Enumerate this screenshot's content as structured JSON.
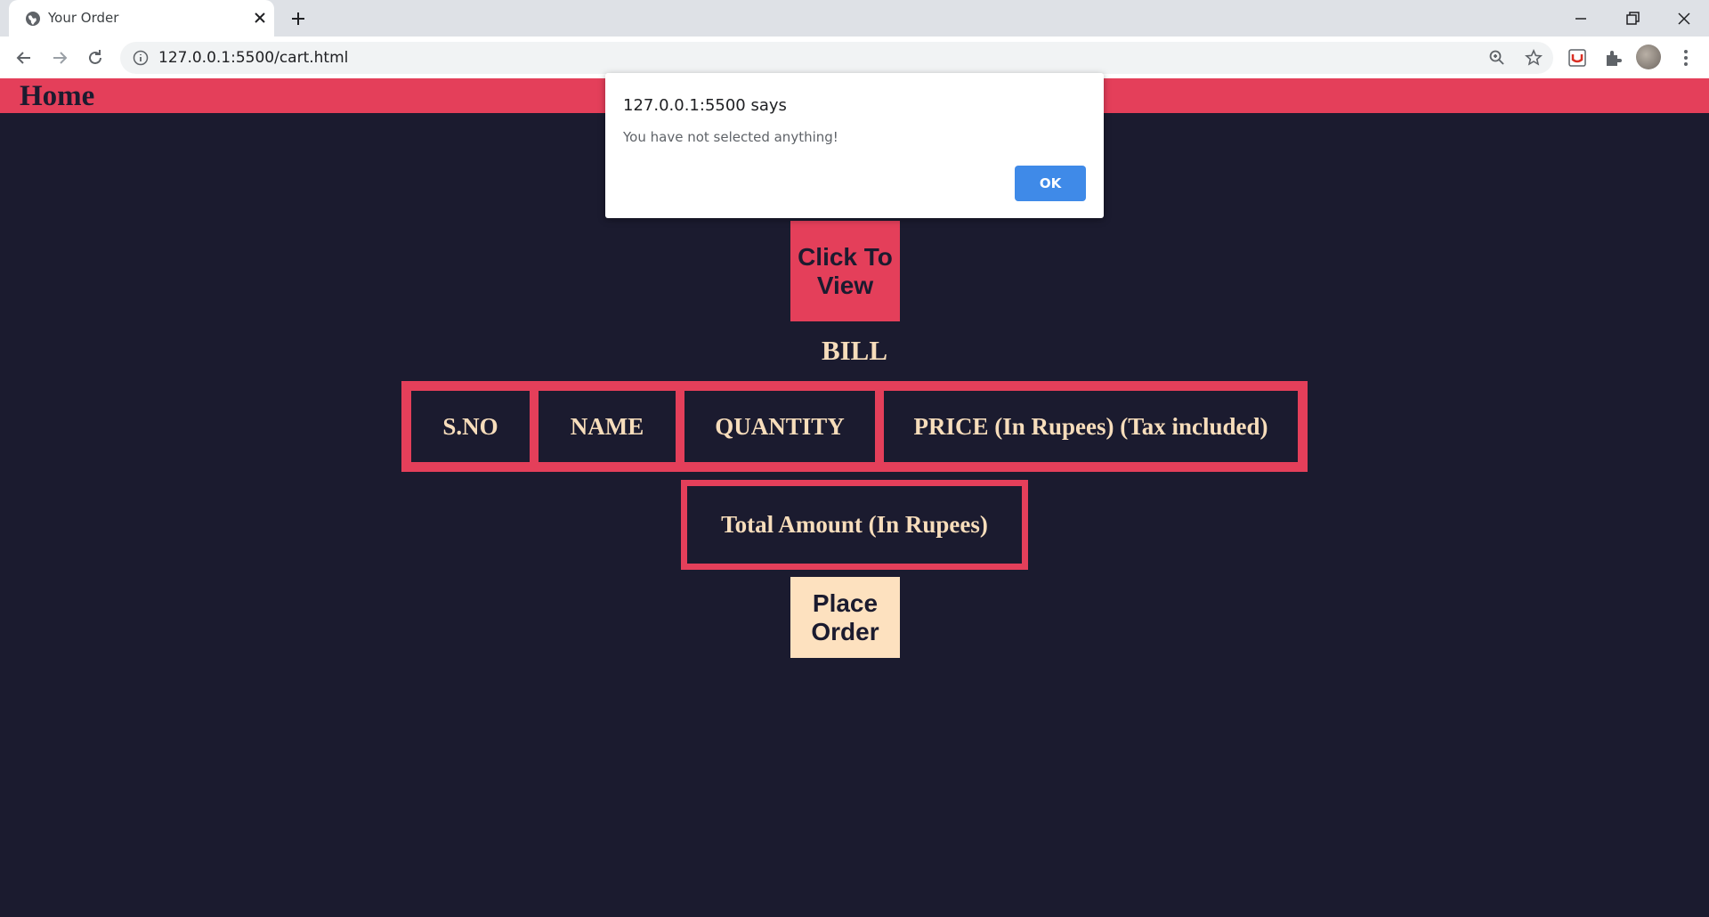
{
  "browser": {
    "tab_title": "Your Order",
    "url": "127.0.0.1:5500/cart.html"
  },
  "page": {
    "nav": {
      "home_label": "Home"
    },
    "view_button_label": "Click To View",
    "bill_title": "BILL",
    "table_headers": [
      "S.NO",
      "NAME",
      "QUANTITY",
      "PRICE (In Rupees) (Tax included)"
    ],
    "total_label": "Total Amount (In Rupees)",
    "place_order_label": "Place Order"
  },
  "alert": {
    "origin": "127.0.0.1:5500 says",
    "message": "You have not selected anything!",
    "ok_label": "OK"
  },
  "colors": {
    "accent": "#e43f5a",
    "page_bg": "#1b1b2f",
    "text_light": "#f7ddbb",
    "order_button_bg": "#fde1bf",
    "dialog_button": "#3f8ae8"
  },
  "icons": [
    "globe-icon",
    "close-icon",
    "plus-icon",
    "minimize-icon",
    "restore-icon",
    "back-icon",
    "forward-icon",
    "reload-icon",
    "info-icon",
    "zoom-icon",
    "star-icon",
    "extension-icon",
    "puzzle-icon",
    "menu-icon"
  ]
}
